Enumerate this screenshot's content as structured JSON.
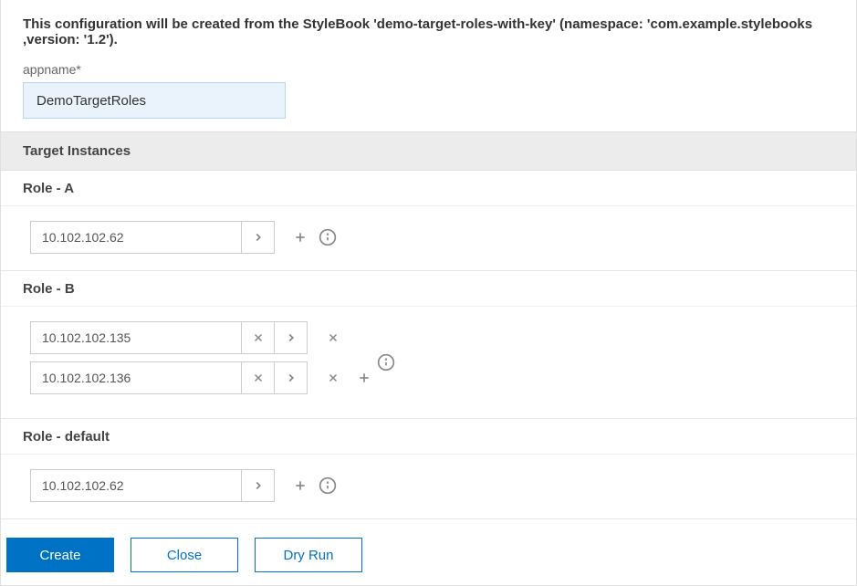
{
  "header": {
    "description": "This configuration will be created from the StyleBook 'demo-target-roles-with-key' (namespace: 'com.example.stylebooks ,version: '1.2')."
  },
  "appname": {
    "label": "appname*",
    "value": "DemoTargetRoles"
  },
  "target_section": {
    "title": "Target Instances"
  },
  "roles": {
    "a": {
      "label": "Role - A",
      "row1": {
        "value": "10.102.102.62"
      }
    },
    "b": {
      "label": "Role - B",
      "row1": {
        "value": "10.102.102.135"
      },
      "row2": {
        "value": "10.102.102.136"
      }
    },
    "default": {
      "label": "Role - default",
      "row1": {
        "value": "10.102.102.62"
      }
    }
  },
  "footer": {
    "create": "Create",
    "close": "Close",
    "dry_run": "Dry Run"
  }
}
